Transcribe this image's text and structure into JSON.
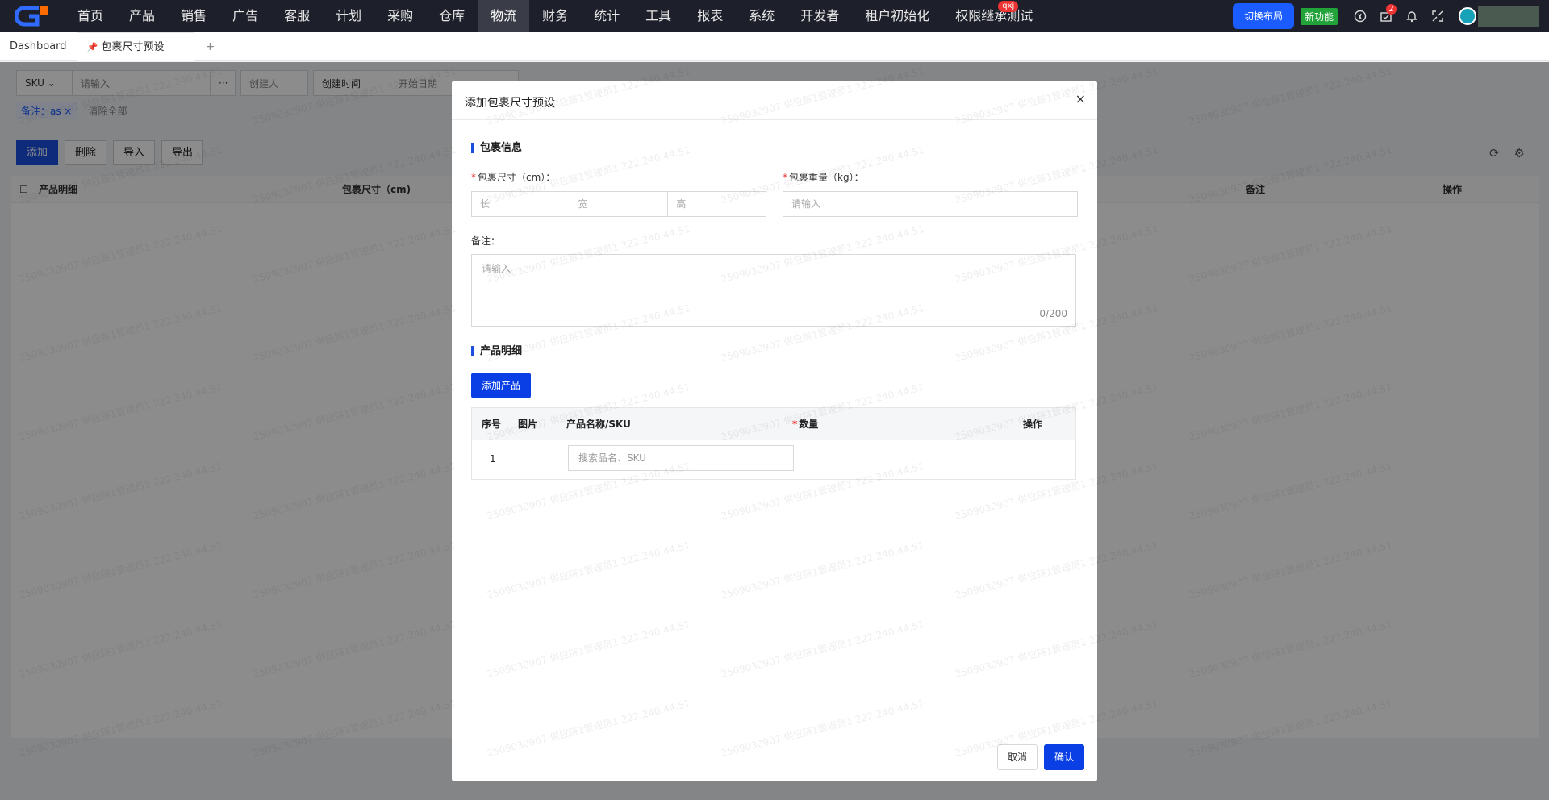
{
  "topnav": {
    "items": [
      "首页",
      "产品",
      "销售",
      "广告",
      "客服",
      "计划",
      "采购",
      "仓库",
      "物流",
      "财务",
      "统计",
      "工具",
      "报表",
      "系统",
      "开发者",
      "租户初始化",
      "权限继承测试"
    ],
    "active_index": 8,
    "badge_label": "qxj",
    "switch_layout": "切换布局",
    "new_feature": "新功能",
    "message_count": "2"
  },
  "tabs": {
    "home": "Dashboard",
    "current": "包裹尺寸预设",
    "add": "+"
  },
  "bg": {
    "sku_select": "SKU",
    "search_placeholder": "请输入",
    "more": "···",
    "creator": "创建人",
    "created_time": "创建时间",
    "start_date": "开始日期",
    "tag_remark": "备注：as",
    "clear_all": "清除全部",
    "btn_add": "添加",
    "btn_delete": "删除",
    "btn_import": "导入",
    "btn_export": "导出",
    "col_product": "产品明细",
    "col_size": "包裹尺寸（cm)",
    "col_remark": "备注",
    "col_action": "操作"
  },
  "modal": {
    "title": "添加包裹尺寸预设",
    "close": "×",
    "section_package": "包裹信息",
    "size_label": "包裹尺寸（cm）：",
    "weight_label": "包裹重量（kg）：",
    "req_mark": "*",
    "dim_length": "长",
    "dim_width": "宽",
    "dim_height": "高",
    "weight_placeholder": "请输入",
    "remark_label": "备注：",
    "remark_placeholder": "请输入",
    "remark_counter": "0/200",
    "section_products": "产品明细",
    "add_product": "添加产品",
    "table": {
      "col_no": "序号",
      "col_image": "图片",
      "col_name": "产品名称/SKU",
      "col_qty": "数量",
      "col_action": "操作",
      "row_no": "1",
      "search_placeholder": "搜索品名、SKU"
    },
    "cancel": "取消",
    "confirm": "确认"
  },
  "watermark": "2509030907 供应链1管理员1 222.240.44.51",
  "colors": {
    "primary": "#0b3fe6",
    "nav_bg": "#1d1f2a",
    "danger": "#e33333"
  }
}
